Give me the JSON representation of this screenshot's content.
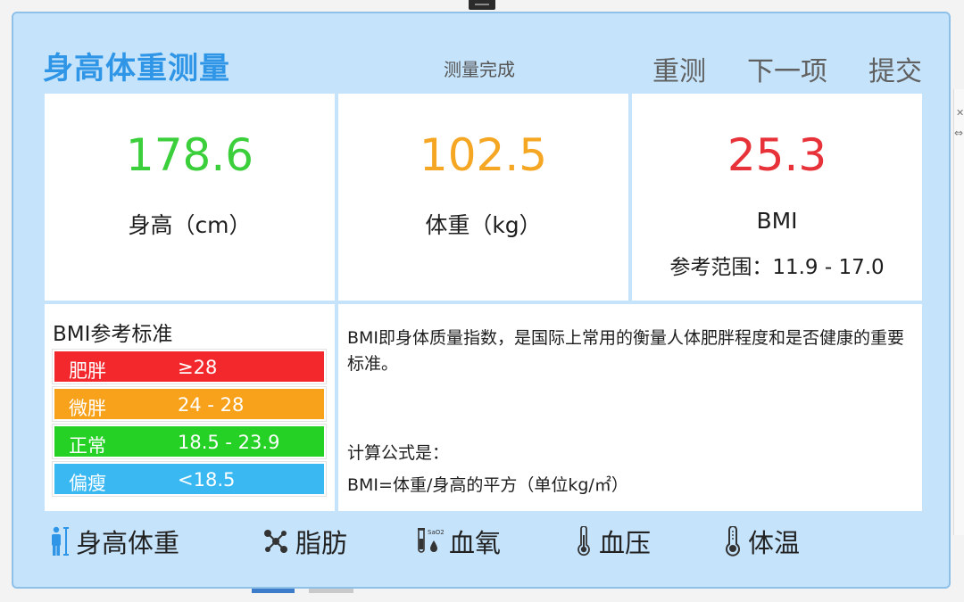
{
  "header": {
    "title": "身高体重测量",
    "status": "测量完成",
    "actions": [
      "重测",
      "下一项",
      "提交"
    ]
  },
  "metrics": [
    {
      "value": "178.6",
      "label": "身高（cm）",
      "color": "#3ccf3c"
    },
    {
      "value": "102.5",
      "label": "体重（kg）",
      "color": "#f5a623"
    },
    {
      "value": "25.3",
      "label": "BMI",
      "sub": "参考范围：11.9 - 17.0",
      "color": "#e8323a"
    }
  ],
  "reference": {
    "title": "BMI参考标准",
    "rows": [
      {
        "name": "肥胖",
        "range": "≥28",
        "color": "#f2282d"
      },
      {
        "name": "微胖",
        "range": "24 - 28",
        "color": "#f7a21a"
      },
      {
        "name": "正常",
        "range": "18.5 - 23.9",
        "color": "#26d126"
      },
      {
        "name": "偏瘦",
        "range": "<18.5",
        "color": "#39b8f2"
      }
    ]
  },
  "description": {
    "text": "BMI即身体质量指数，是国际上常用的衡量人体肥胖程度和是否健康的重要标准。",
    "formula_label": "计算公式是：",
    "formula": "BMI=体重/身高的平方（单位kg/㎡）"
  },
  "nav": [
    {
      "label": "身高体重",
      "icon": "person-height-icon",
      "active": true
    },
    {
      "label": "脂肪",
      "icon": "molecule-icon"
    },
    {
      "label": "血氧",
      "icon": "spo2-tube-icon",
      "icon_text": "SaO2"
    },
    {
      "label": "血压",
      "icon": "thermometer-icon"
    },
    {
      "label": "体温",
      "icon": "thermometer-icon"
    }
  ],
  "colors": {
    "accent": "#2f95e6",
    "panel_bg": "#c5e3fa"
  }
}
